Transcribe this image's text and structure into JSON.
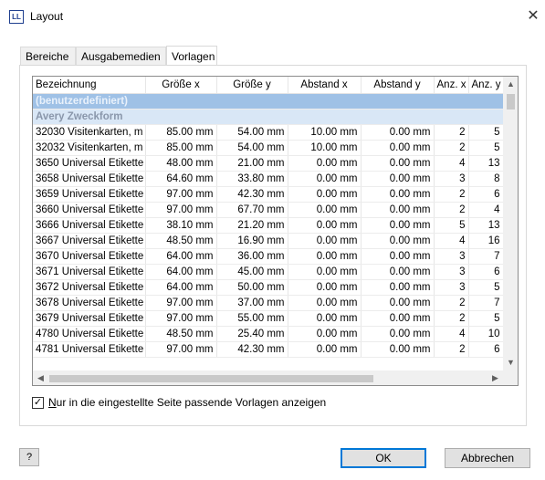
{
  "window": {
    "title": "Layout",
    "icon": "LL"
  },
  "tabs": [
    {
      "label": "Bereiche",
      "active": false
    },
    {
      "label": "Ausgabemedien",
      "active": false
    },
    {
      "label": "Vorlagen",
      "active": true
    }
  ],
  "table": {
    "columns": [
      "Bezeichnung",
      "Größe x",
      "Größe y",
      "Abstand x",
      "Abstand y",
      "Anz. x",
      "Anz. y"
    ],
    "groups": [
      {
        "label": "(benutzerdefiniert)"
      },
      {
        "label": "Avery Zweckform"
      }
    ],
    "rows": [
      [
        "32030 Visitenkarten, m",
        "85.00 mm",
        "54.00 mm",
        "10.00 mm",
        "0.00 mm",
        "2",
        "5"
      ],
      [
        "32032 Visitenkarten, m",
        "85.00 mm",
        "54.00 mm",
        "10.00 mm",
        "0.00 mm",
        "2",
        "5"
      ],
      [
        "3650 Universal Etikette",
        "48.00 mm",
        "21.00 mm",
        "0.00 mm",
        "0.00 mm",
        "4",
        "13"
      ],
      [
        "3658 Universal Etikette",
        "64.60 mm",
        "33.80 mm",
        "0.00 mm",
        "0.00 mm",
        "3",
        "8"
      ],
      [
        "3659 Universal Etikette",
        "97.00 mm",
        "42.30 mm",
        "0.00 mm",
        "0.00 mm",
        "2",
        "6"
      ],
      [
        "3660 Universal Etikette",
        "97.00 mm",
        "67.70 mm",
        "0.00 mm",
        "0.00 mm",
        "2",
        "4"
      ],
      [
        "3666 Universal Etikette",
        "38.10 mm",
        "21.20 mm",
        "0.00 mm",
        "0.00 mm",
        "5",
        "13"
      ],
      [
        "3667 Universal Etikette",
        "48.50 mm",
        "16.90 mm",
        "0.00 mm",
        "0.00 mm",
        "4",
        "16"
      ],
      [
        "3670 Universal Etikette",
        "64.00 mm",
        "36.00 mm",
        "0.00 mm",
        "0.00 mm",
        "3",
        "7"
      ],
      [
        "3671 Universal Etikette",
        "64.00 mm",
        "45.00 mm",
        "0.00 mm",
        "0.00 mm",
        "3",
        "6"
      ],
      [
        "3672 Universal Etikette",
        "64.00 mm",
        "50.00 mm",
        "0.00 mm",
        "0.00 mm",
        "3",
        "5"
      ],
      [
        "3678 Universal Etikette",
        "97.00 mm",
        "37.00 mm",
        "0.00 mm",
        "0.00 mm",
        "2",
        "7"
      ],
      [
        "3679 Universal Etikette",
        "97.00 mm",
        "55.00 mm",
        "0.00 mm",
        "0.00 mm",
        "2",
        "5"
      ],
      [
        "4780 Universal Etikette",
        "48.50 mm",
        "25.40 mm",
        "0.00 mm",
        "0.00 mm",
        "4",
        "10"
      ],
      [
        "4781 Universal Etikette",
        "97.00 mm",
        "42.30 mm",
        "0.00 mm",
        "0.00 mm",
        "2",
        "6"
      ]
    ]
  },
  "checkbox": {
    "label": "Nur in die eingestellte Seite passende Vorlagen anzeigen",
    "mnemonic": "N",
    "rest": "ur in die eingestellte Seite passende Vorlagen anzeigen",
    "checked": true
  },
  "buttons": {
    "help": "?",
    "ok": "OK",
    "cancel": "Abbrechen"
  },
  "colors": {
    "group_selected": "#9fc1e6",
    "group": "#d9e7f6",
    "default_button_border": "#0078d7"
  }
}
